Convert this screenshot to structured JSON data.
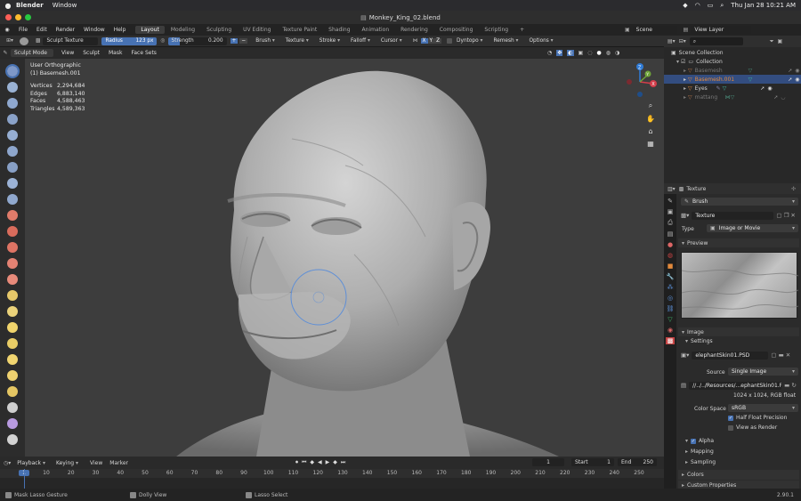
{
  "mac_menu": {
    "app_name": "Blender",
    "items": [
      "Window"
    ],
    "datetime": "Thu Jan 28  10:21 AM"
  },
  "window": {
    "title": "Monkey_King_02.blend"
  },
  "topbar": {
    "menus": [
      "File",
      "Edit",
      "Render",
      "Window",
      "Help"
    ],
    "workspaces": [
      "Layout",
      "Modeling",
      "Sculpting",
      "UV Editing",
      "Texture Paint",
      "Shading",
      "Animation",
      "Rendering",
      "Compositing",
      "Scripting"
    ],
    "active_workspace": "Layout",
    "scene": "Scene",
    "view_layer": "View Layer"
  },
  "tool_header": {
    "brush_name": "Sculpt Texture",
    "radius_label": "Radius",
    "radius_value": "123 px",
    "strength_label": "Strength",
    "strength_value": "0.200",
    "menus": [
      "Brush",
      "Texture",
      "Stroke",
      "Falloff",
      "Cursor"
    ],
    "axes": [
      "X",
      "Y",
      "Z"
    ],
    "dyntopo": "Dyntopo",
    "remesh": "Remesh",
    "options": "Options"
  },
  "viewport_header": {
    "mode": "Sculpt Mode",
    "menus": [
      "View",
      "Sculpt",
      "Mask",
      "Face Sets"
    ]
  },
  "viewport": {
    "view_name": "User Orthographic",
    "object_name": "(1) Basemesh.001",
    "stats": [
      {
        "label": "Vertices",
        "value": "2,294,684"
      },
      {
        "label": "Edges",
        "value": "6,883,140"
      },
      {
        "label": "Faces",
        "value": "4,588,463"
      },
      {
        "label": "Triangles",
        "value": "4,589,363"
      }
    ],
    "gizmo_axes": [
      "Z",
      "Y",
      "X"
    ]
  },
  "outliner": {
    "scene_collection": "Scene Collection",
    "collection": "Collection",
    "objects": [
      "Basemesh",
      "Basemesh.001",
      "Eyes",
      "mattang"
    ]
  },
  "properties": {
    "header": "Texture",
    "brush": "Brush",
    "texture_name": "Texture",
    "type_label": "Type",
    "type_value": "Image or Movie",
    "preview_label": "Preview",
    "image_label": "Image",
    "settings_label": "Settings",
    "image_name": "elephantSkin01.PSD",
    "source_label": "Source",
    "source_value": "Single Image",
    "path": "//../../Resources/...ephantSkin01.PSD",
    "image_info": "1024 x 1024,  RGB float",
    "color_space_label": "Color Space",
    "color_space_value": "sRGB",
    "half_float": "Half Float Precision",
    "view_as_render": "View as Render",
    "alpha": "Alpha",
    "mapping": "Mapping",
    "sampling": "Sampling",
    "colors": "Colors",
    "custom_props": "Custom Properties"
  },
  "timeline": {
    "menus": [
      "Playback",
      "Keying",
      "View",
      "Marker"
    ],
    "current_frame": "1",
    "start_label": "Start",
    "start": "1",
    "end_label": "End",
    "end": "250",
    "ticks": [
      "1",
      "10",
      "20",
      "30",
      "40",
      "50",
      "60",
      "70",
      "80",
      "90",
      "100",
      "110",
      "120",
      "130",
      "140",
      "150",
      "160",
      "170",
      "180",
      "190",
      "200",
      "210",
      "220",
      "230",
      "240",
      "250"
    ]
  },
  "statusbar": {
    "items": [
      "Mask Lasso Gesture",
      "Dolly View",
      "Lasso Select"
    ],
    "version": "2.90.1"
  },
  "colors": {
    "accent": "#4772b3",
    "selected_row": "#334d80",
    "object_orange": "#e38a3c"
  }
}
